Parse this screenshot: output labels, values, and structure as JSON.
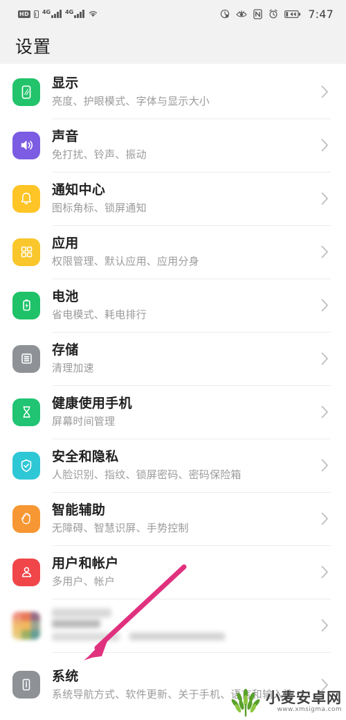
{
  "statusbar": {
    "hd_badge": "HD",
    "network_label_1": "4G",
    "network_label_2": "4G",
    "time": "7:47",
    "left_icons": [
      "hd-icon",
      "volte-icon",
      "signal-4g-icon-1",
      "signal-4g-icon-2",
      "wifi-icon"
    ],
    "right_icons": [
      "data-saver-icon",
      "eye-comfort-icon",
      "nfc-icon",
      "alarm-icon",
      "battery-icon"
    ]
  },
  "header": {
    "title": "设置"
  },
  "colors": {
    "display": "#22c36b",
    "sound": "#7b5ce2",
    "notification": "#ffc426",
    "apps": "#f9c62b",
    "battery": "#1fc268",
    "storage": "#8e9296",
    "digital_balance": "#20c473",
    "security": "#2ec7d6",
    "assistance": "#f79733",
    "accounts": "#f0464a",
    "system": "#8e9296",
    "arrow": "#e0317f",
    "chevron": "#bdbdbd",
    "divider": "#ececec"
  },
  "list": {
    "items": [
      {
        "icon": "display-icon",
        "title": "显示",
        "subtitle": "亮度、护眼模式、字体与显示大小",
        "color_key": "display",
        "chevron": "chevron-right-icon"
      },
      {
        "icon": "sound-icon",
        "title": "声音",
        "subtitle": "免打扰、铃声、振动",
        "color_key": "sound",
        "chevron": "chevron-right-icon"
      },
      {
        "icon": "bell-icon",
        "title": "通知中心",
        "subtitle": "图标角标、锁屏通知",
        "color_key": "notification",
        "chevron": "chevron-right-icon"
      },
      {
        "icon": "apps-grid-icon",
        "title": "应用",
        "subtitle": "权限管理、默认应用、应用分身",
        "color_key": "apps",
        "chevron": "chevron-right-icon"
      },
      {
        "icon": "battery-icon",
        "title": "电池",
        "subtitle": "省电模式、耗电排行",
        "color_key": "battery",
        "chevron": "chevron-right-icon"
      },
      {
        "icon": "storage-icon",
        "title": "存储",
        "subtitle": "清理加速",
        "color_key": "storage",
        "chevron": "chevron-right-icon"
      },
      {
        "icon": "hourglass-icon",
        "title": "健康使用手机",
        "subtitle": "屏幕时间管理",
        "color_key": "digital_balance",
        "chevron": "chevron-right-icon"
      },
      {
        "icon": "shield-check-icon",
        "title": "安全和隐私",
        "subtitle": "人脸识别、指纹、锁屏密码、密码保险箱",
        "color_key": "security",
        "chevron": "chevron-right-icon"
      },
      {
        "icon": "hand-icon",
        "title": "智能辅助",
        "subtitle": "无障碍、智慧识屏、手势控制",
        "color_key": "assistance",
        "chevron": "chevron-right-icon"
      },
      {
        "icon": "user-account-icon",
        "title": "用户和帐户",
        "subtitle": "多用户、帐户",
        "color_key": "accounts",
        "chevron": "chevron-right-icon"
      }
    ],
    "censored_item": {
      "icon": "blurred-multicolor-icon",
      "title": "",
      "subtitle": "",
      "chevron": "chevron-right-icon"
    },
    "system_item": {
      "icon": "system-info-icon",
      "title": "系统",
      "subtitle": "系统导航方式、软件更新、关于手机、语言和输入法",
      "color_key": "system",
      "chevron": "chevron-right-icon"
    }
  },
  "annotation": {
    "type": "arrow",
    "name": "pink-arrow-annotation",
    "points_to": "系统"
  },
  "watermark": {
    "title": "小麦安卓网",
    "url": "www.xmsigma.com",
    "logo": "wheat-logo-icon"
  }
}
